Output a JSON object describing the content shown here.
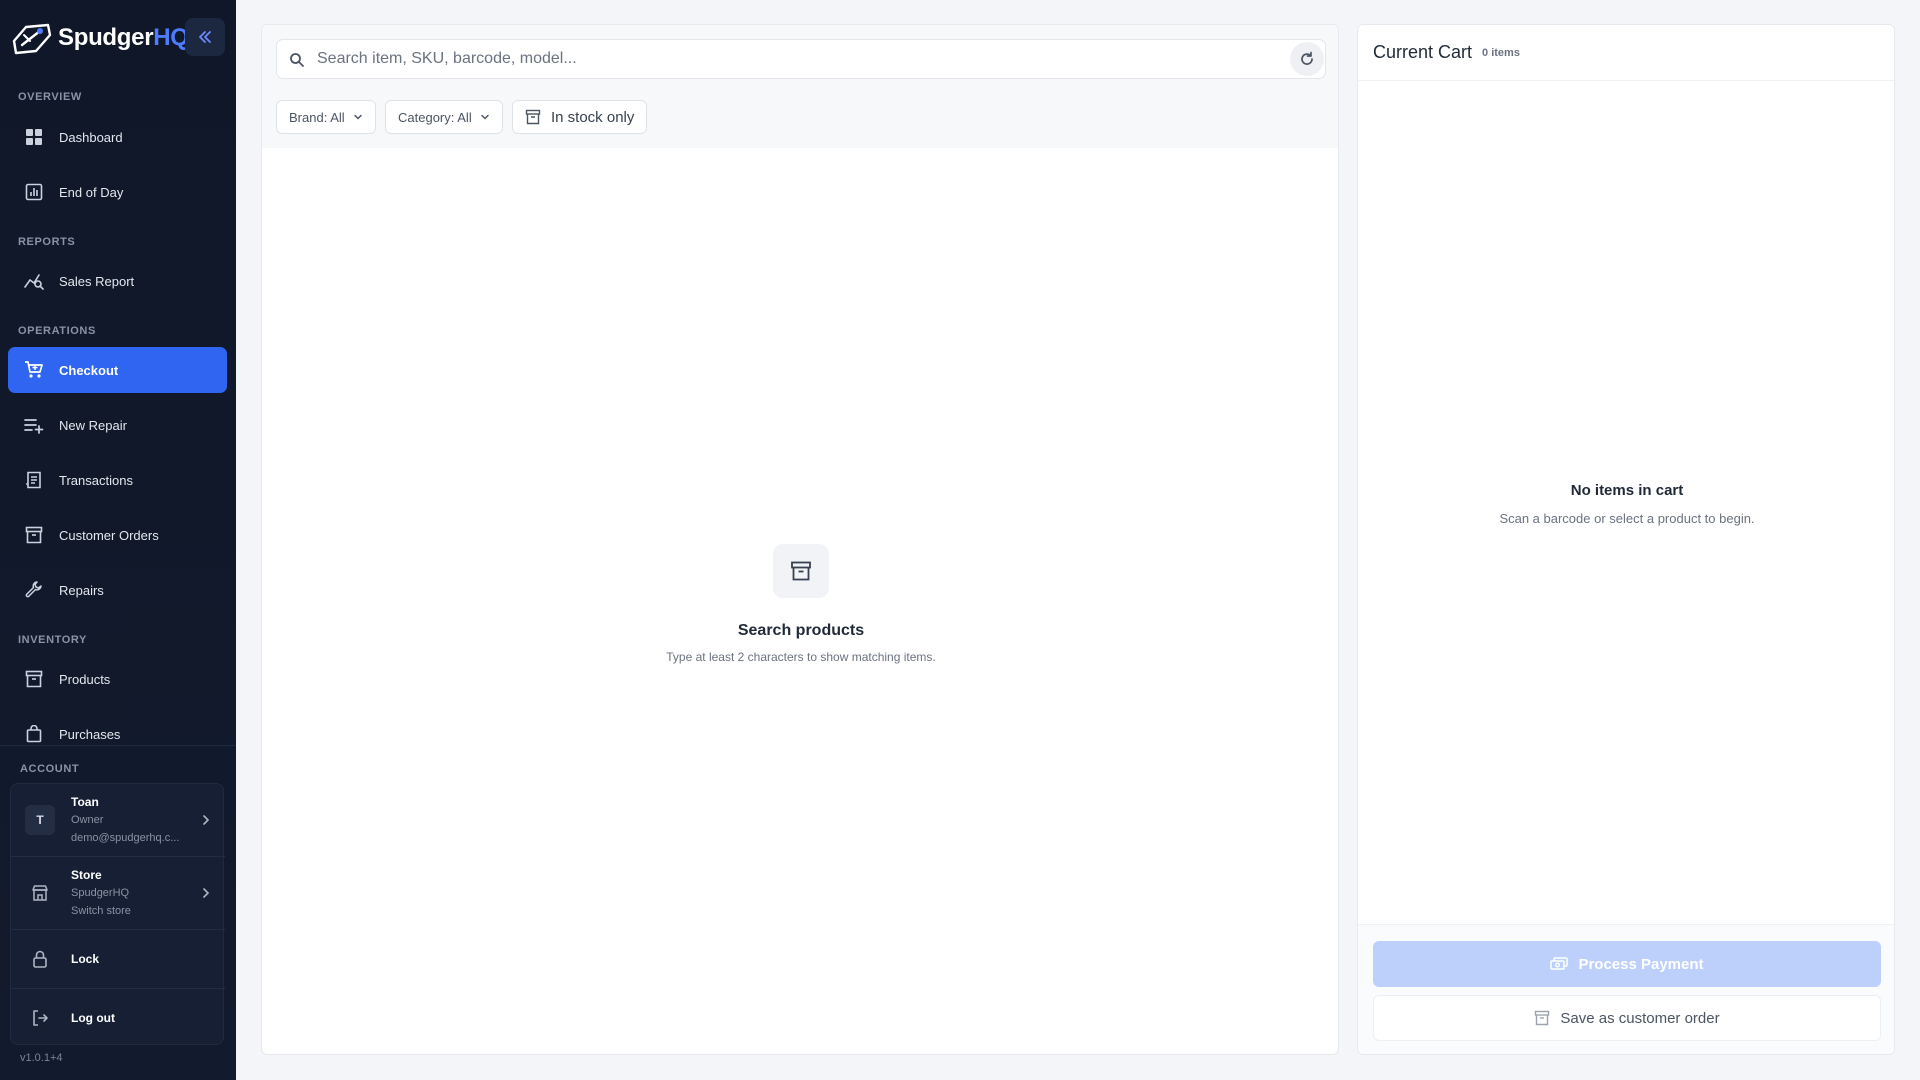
{
  "brand": {
    "name_main": "Spudger",
    "name_accent": "HQ"
  },
  "sidebar": {
    "collapse_icon": "double-chevron-left-icon",
    "sections": {
      "overview": "OVERVIEW",
      "reports": "REPORTS",
      "operations": "OPERATIONS",
      "inventory": "INVENTORY",
      "account": "ACCOUNT"
    },
    "items": {
      "dashboard": "Dashboard",
      "end_of_day": "End of Day",
      "sales_report": "Sales Report",
      "checkout": "Checkout",
      "new_repair": "New Repair",
      "transactions": "Transactions",
      "customer_orders": "Customer Orders",
      "repairs": "Repairs",
      "products": "Products",
      "purchases": "Purchases"
    },
    "active_item": "checkout"
  },
  "account": {
    "user": {
      "initial": "T",
      "name": "Toan",
      "role": "Owner",
      "email": "demo@spudgerhq.c..."
    },
    "store": {
      "title": "Store",
      "name": "SpudgerHQ",
      "action": "Switch store"
    },
    "lock_label": "Lock",
    "logout_label": "Log out"
  },
  "version": "v1.0.1+4",
  "search": {
    "placeholder": "Search item, SKU, barcode, model...",
    "value": ""
  },
  "filters": {
    "brand": "Brand: All",
    "category": "Category: All",
    "stock": "In stock only"
  },
  "empty_state": {
    "title": "Search products",
    "subtitle": "Type at least 2 characters to show matching items."
  },
  "cart": {
    "title": "Current Cart",
    "count": "0 items",
    "empty_title": "No items in cart",
    "empty_subtitle": "Scan a barcode or select a product to begin.",
    "process_payment": "Process Payment",
    "save_order": "Save as customer order"
  },
  "colors": {
    "accent": "#2f65f0",
    "sidebar_bg": "#0f1728",
    "payment_disabled": "#bcd0fb"
  }
}
